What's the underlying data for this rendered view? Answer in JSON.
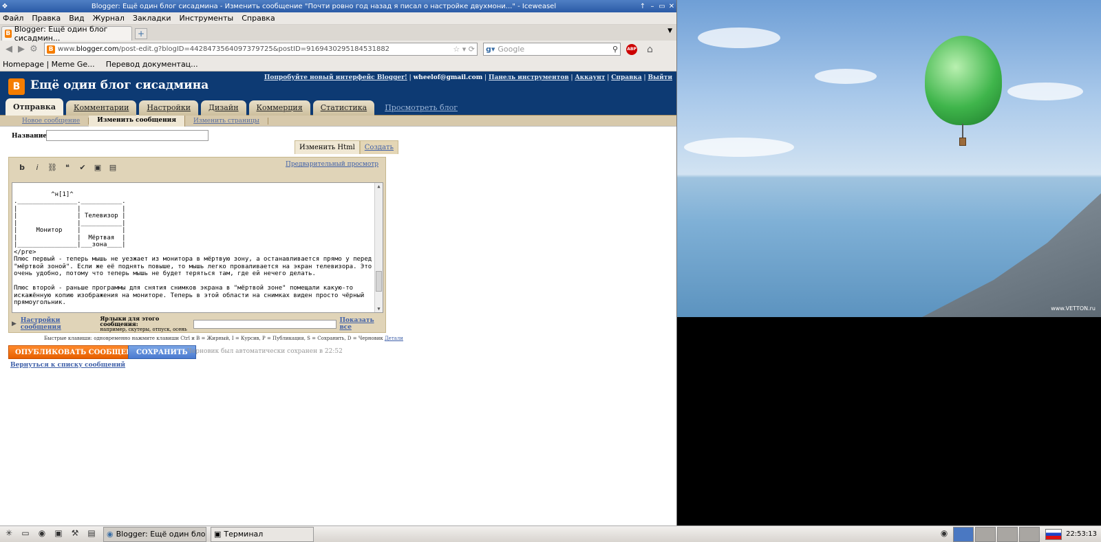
{
  "window": {
    "title": "Blogger: Ещё один блог сисадмина - Изменить сообщение \"Почти ровно год назад я писал о настройке двухмони...\" - Iceweasel"
  },
  "menu": [
    "Файл",
    "Правка",
    "Вид",
    "Журнал",
    "Закладки",
    "Инструменты",
    "Справка"
  ],
  "tabs": [
    {
      "label": "Blogger: Ещё один блог сисадмин..."
    }
  ],
  "url": {
    "prefix": "www.",
    "domain": "blogger.com",
    "path": "/post-edit.g?blogID=4428473564097379725&postID=9169430295184531882"
  },
  "search": {
    "placeholder": "Google"
  },
  "bookmarks": [
    "Homepage | Meme Ge...",
    "Перевод документац..."
  ],
  "blog": {
    "title": "Ещё один блог сисадмина",
    "toplinks": {
      "try_new": "Попробуйте новый интерфейс Blogger!",
      "email": "wheelof@gmail.com",
      "dashboard": "Панель инструментов",
      "account": "Аккаунт",
      "help": "Справка",
      "logout": "Выйти"
    },
    "tabs": [
      "Отправка",
      "Комментарии",
      "Настройки",
      "Дизайн",
      "Коммерция",
      "Статистика"
    ],
    "view_blog": "Просмотреть блог",
    "subtabs": [
      "Новое сообщение",
      "Изменить сообщения",
      "Изменить страницы"
    ]
  },
  "editor": {
    "name_label": "Название:",
    "name_value": "",
    "tab_html": "Изменить Html",
    "tab_compose": "Создать",
    "preview": "Предварительный просмотр",
    "text": "^н[1]^\n.________________.___________.\n|                |           |\n|                | Телевизор |\n|                |___________|\n|     Монитор    |           |\n|                |  Мёртвая  |\n|________________|___зона____|\n</pre>\nПлюс первый - теперь мышь не уезжает из монитора в мёртвую зону, а останавливается прямо у перед\n\"мёртвой зоной\". Если же её поднять повыше, то мышь легко проваливается на экран телевизора. Это\nочень удобно, потому что теперь мышь не будет теряться там, где ей нечего делать.\n\nПлюс второй - раньше программы для снятия снимков экрана в \"мёртвой зоне\" помещали какую-то\nискажённую копию изображения на мониторе. Теперь в этой области на снимках виден просто чёрный\nпрямоугольник.\n\nНу и третий плюс - программы перестали ругаться на отсутствие поддержки XRandr.\n",
    "post_settings": "Настройки сообщения",
    "labels_title": "Ярлыки для этого сообщения:",
    "labels_hint": "например, скутеры, отпуск, осень",
    "labels_value": "",
    "show_all": "Показать все",
    "hotkeys": "Быстрые клавиши: одновременно нажмите клавиши Ctrl и B = Жирный, I = Курсив, P = Публикация, S = Сохранить, D = Черновик",
    "hotkeys_more": "Детали",
    "publish": "ОПУБЛИКОВАТЬ СООБЩЕНИЕ",
    "save": "СОХРАНИТЬ",
    "autosave": "Черновик был автоматически сохранен в 22:52",
    "back": "Вернуться к списку сообщений"
  },
  "taskbar": {
    "tasks": [
      "Blogger: Ещё один блог с...",
      "Терминал"
    ],
    "clock": "22:53:13"
  },
  "wallpaper": {
    "watermark": "www.VETTON.ru"
  }
}
